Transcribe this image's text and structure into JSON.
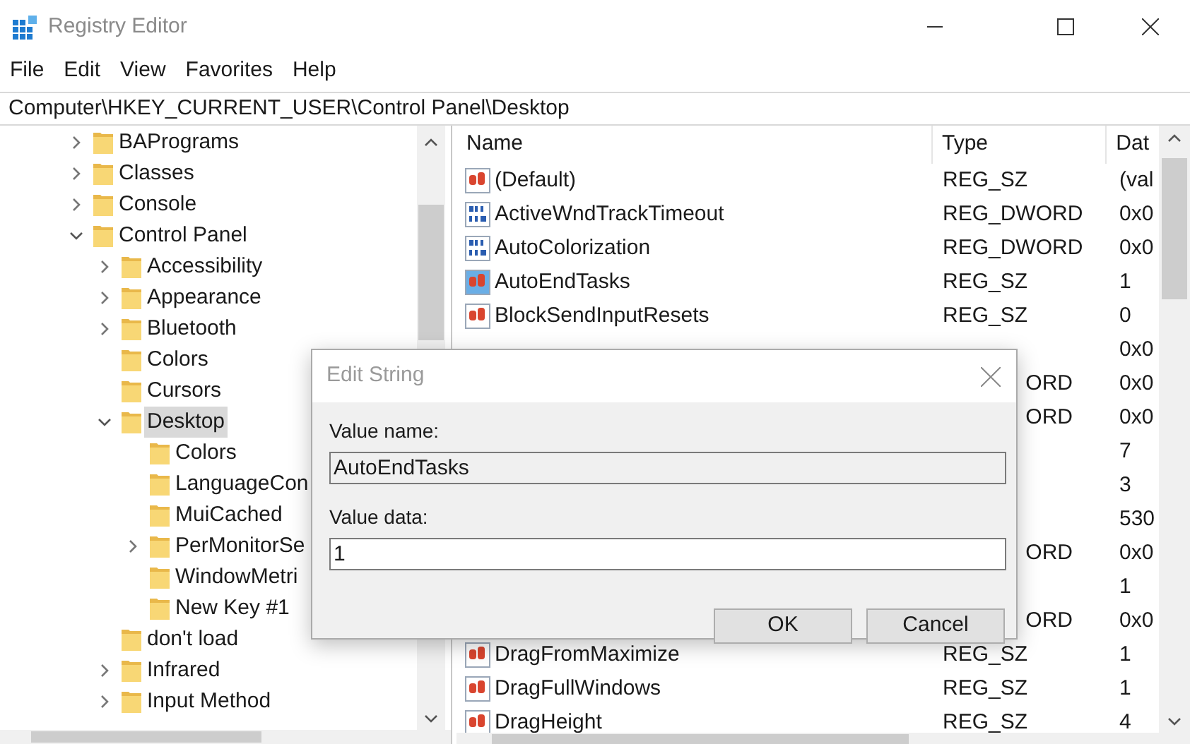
{
  "window": {
    "title": "Registry Editor"
  },
  "menu": [
    "File",
    "Edit",
    "View",
    "Favorites",
    "Help"
  ],
  "address": "Computer\\HKEY_CURRENT_USER\\Control Panel\\Desktop",
  "tree": [
    {
      "label": "BAPrograms",
      "kind": "branch",
      "expanded": false,
      "selected": false
    },
    {
      "label": "Classes",
      "kind": "branch",
      "expanded": false,
      "selected": false
    },
    {
      "label": "Console",
      "kind": "branch",
      "expanded": false,
      "selected": false
    },
    {
      "label": "Control Panel",
      "kind": "branch",
      "expanded": true,
      "selected": false,
      "children": [
        {
          "label": "Accessibility",
          "kind": "branch",
          "expanded": false,
          "selected": false
        },
        {
          "label": "Appearance",
          "kind": "branch",
          "expanded": false,
          "selected": false
        },
        {
          "label": "Bluetooth",
          "kind": "branch",
          "expanded": false,
          "selected": false
        },
        {
          "label": "Colors",
          "kind": "leaf",
          "selected": false
        },
        {
          "label": "Cursors",
          "kind": "leaf",
          "selected": false
        },
        {
          "label": "Desktop",
          "kind": "branch",
          "expanded": true,
          "selected": true,
          "children": [
            {
              "label": "Colors",
              "kind": "leaf",
              "selected": false
            },
            {
              "label": "LanguageCon",
              "kind": "leaf",
              "selected": false
            },
            {
              "label": "MuiCached",
              "kind": "leaf",
              "selected": false
            },
            {
              "label": "PerMonitorSe",
              "kind": "branch",
              "expanded": false,
              "selected": false
            },
            {
              "label": "WindowMetri",
              "kind": "leaf",
              "selected": false
            },
            {
              "label": "New Key #1",
              "kind": "leaf",
              "selected": false
            }
          ]
        },
        {
          "label": "don't load",
          "kind": "leaf",
          "selected": false
        },
        {
          "label": "Infrared",
          "kind": "branch",
          "expanded": false,
          "selected": false
        },
        {
          "label": "Input Method",
          "kind": "branch",
          "expanded": false,
          "selected": false
        }
      ]
    }
  ],
  "list": {
    "columns": [
      "Name",
      "Type",
      "Dat"
    ],
    "rows": [
      {
        "kind": "string",
        "name": "(Default)",
        "type": "REG_SZ",
        "data": "(val",
        "selected": false
      },
      {
        "kind": "binary",
        "name": "ActiveWndTrackTimeout",
        "type": "REG_DWORD",
        "data": "0x0",
        "selected": false
      },
      {
        "kind": "binary",
        "name": "AutoColorization",
        "type": "REG_DWORD",
        "data": "0x0",
        "selected": false
      },
      {
        "kind": "string",
        "name": "AutoEndTasks",
        "type": "REG_SZ",
        "data": "1",
        "selected": true
      },
      {
        "kind": "string",
        "name": "BlockSendInputResets",
        "type": "REG_SZ",
        "data": "0",
        "selected": false
      },
      {
        "data": "0x0"
      },
      {
        "type": "ORD",
        "data": "0x0"
      },
      {
        "type": "ORD",
        "data": "0x0"
      },
      {
        "data": "7"
      },
      {
        "data": "3"
      },
      {
        "data": "530"
      },
      {
        "type": "ORD",
        "data": "0x0"
      },
      {
        "data": "1"
      },
      {
        "type": "ORD",
        "data": "0x0"
      },
      {
        "kind": "string",
        "name": "DragFromMaximize",
        "type": "REG_SZ",
        "data": "1",
        "selected": false
      },
      {
        "kind": "string",
        "name": "DragFullWindows",
        "type": "REG_SZ",
        "data": "1",
        "selected": false
      },
      {
        "kind": "string",
        "name": "DragHeight",
        "type": "REG_SZ",
        "data": "4",
        "selected": false
      }
    ]
  },
  "dialog": {
    "title": "Edit String",
    "fields": [
      {
        "label": "Value name:",
        "value": "AutoEndTasks",
        "readonly": true
      },
      {
        "label": "Value data:",
        "value": "1",
        "readonly": false
      }
    ],
    "buttons": [
      "OK",
      "Cancel"
    ]
  }
}
